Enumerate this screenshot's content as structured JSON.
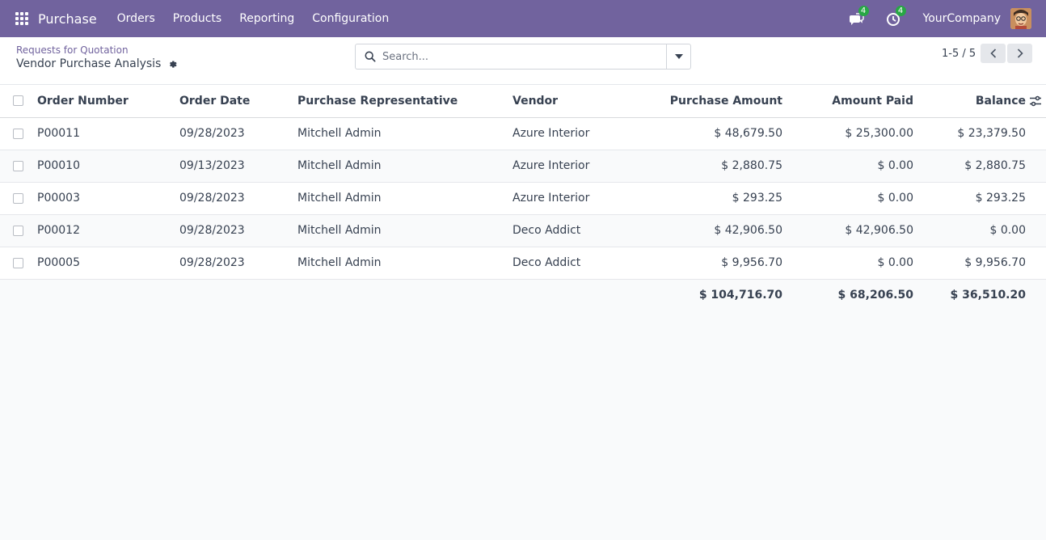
{
  "navbar": {
    "brand": "Purchase",
    "menu": [
      "Orders",
      "Products",
      "Reporting",
      "Configuration"
    ],
    "messages_count": "4",
    "activities_count": "4",
    "company": "YourCompany"
  },
  "breadcrumb": {
    "parent": "Requests for Quotation",
    "current": "Vendor Purchase Analysis"
  },
  "search": {
    "placeholder": "Search..."
  },
  "pager": {
    "text": "1-5 / 5"
  },
  "table": {
    "columns": [
      "Order Number",
      "Order Date",
      "Purchase Representative",
      "Vendor",
      "Purchase Amount",
      "Amount Paid",
      "Balance"
    ],
    "rows": [
      [
        "P00011",
        "09/28/2023",
        "Mitchell Admin",
        "Azure Interior",
        "$ 48,679.50",
        "$ 25,300.00",
        "$ 23,379.50"
      ],
      [
        "P00010",
        "09/13/2023",
        "Mitchell Admin",
        "Azure Interior",
        "$ 2,880.75",
        "$ 0.00",
        "$ 2,880.75"
      ],
      [
        "P00003",
        "09/28/2023",
        "Mitchell Admin",
        "Azure Interior",
        "$ 293.25",
        "$ 0.00",
        "$ 293.25"
      ],
      [
        "P00012",
        "09/28/2023",
        "Mitchell Admin",
        "Deco Addict",
        "$ 42,906.50",
        "$ 42,906.50",
        "$ 0.00"
      ],
      [
        "P00005",
        "09/28/2023",
        "Mitchell Admin",
        "Deco Addict",
        "$ 9,956.70",
        "$ 0.00",
        "$ 9,956.70"
      ]
    ],
    "totals": {
      "purchase_amount": "$ 104,716.70",
      "amount_paid": "$ 68,206.50",
      "balance": "$ 36,510.20"
    }
  },
  "colors": {
    "navbar": "#71639e",
    "badge": "#28a745",
    "link": "#71639e"
  }
}
